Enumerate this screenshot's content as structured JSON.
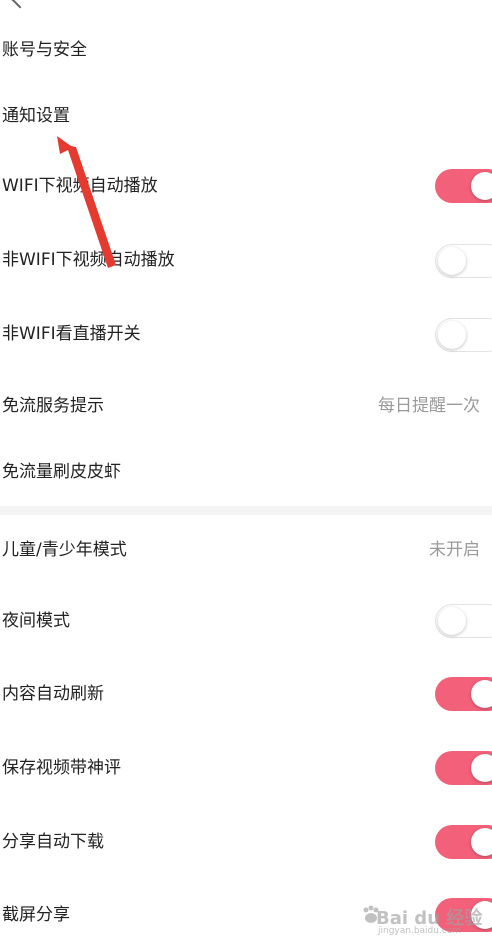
{
  "colors": {
    "accent": "#f2607a",
    "toggle_off_border": "#e2e2e2",
    "secondary_text": "#9a9a9a",
    "annotation_arrow": "#e53a2f"
  },
  "settings": {
    "account_security": {
      "label": "账号与安全"
    },
    "notification": {
      "label": "通知设置"
    },
    "wifi_autoplay": {
      "label": "WIFI下视频自动播放",
      "state": "on"
    },
    "nonwifi_autoplay": {
      "label": "非WIFI下视频自动播放",
      "state": "off"
    },
    "nonwifi_live": {
      "label": "非WIFI看直播开关",
      "state": "off"
    },
    "free_flow_tip": {
      "label": "免流服务提示",
      "value": "每日提醒一次"
    },
    "free_flow_skin": {
      "label": "免流量刷皮皮虾"
    },
    "kids_mode": {
      "label": "儿童/青少年模式",
      "value": "未开启"
    },
    "night_mode": {
      "label": "夜间模式",
      "state": "off"
    },
    "auto_refresh": {
      "label": "内容自动刷新",
      "state": "on"
    },
    "save_with_comment": {
      "label": "保存视频带神评",
      "state": "on"
    },
    "share_auto_download": {
      "label": "分享自动下载",
      "state": "on"
    },
    "screenshot_share": {
      "label": "截屏分享",
      "state": "on"
    }
  },
  "watermark": {
    "brand": "Bai du 经验",
    "sub": "jingyan.baidu.com",
    "icon": "baidu-paw-icon"
  }
}
